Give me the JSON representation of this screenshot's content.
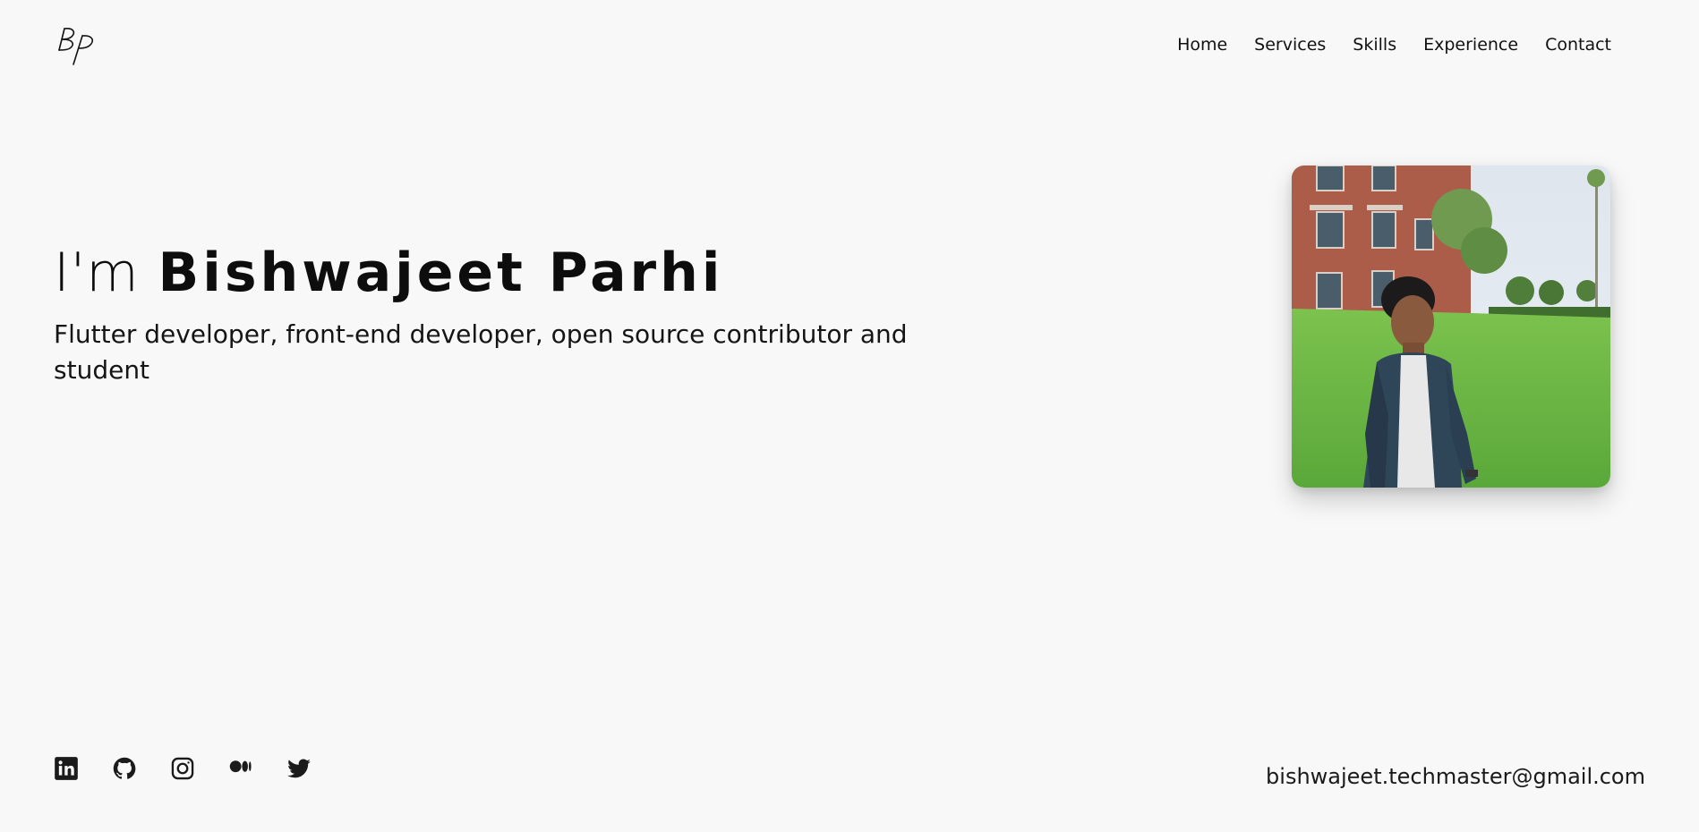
{
  "logo": {
    "text": "BP",
    "icon": "bp-monogram-logo"
  },
  "nav": {
    "items": [
      {
        "label": "Home"
      },
      {
        "label": "Services"
      },
      {
        "label": "Skills"
      },
      {
        "label": "Experience"
      },
      {
        "label": "Contact"
      }
    ]
  },
  "hero": {
    "intro": "I'm",
    "name": "Bishwajeet Parhi",
    "subtitle": "Flutter developer, front-end developer, open source contributor and student"
  },
  "photo": {
    "description_icon": "profile-photo"
  },
  "socials": {
    "icons": [
      "linkedin-icon",
      "github-icon",
      "instagram-icon",
      "medium-icon",
      "twitter-icon"
    ]
  },
  "contact": {
    "email": "bishwajeet.techmaster@gmail.com"
  },
  "colors": {
    "background": "#f8f8f8",
    "text": "#111111"
  }
}
